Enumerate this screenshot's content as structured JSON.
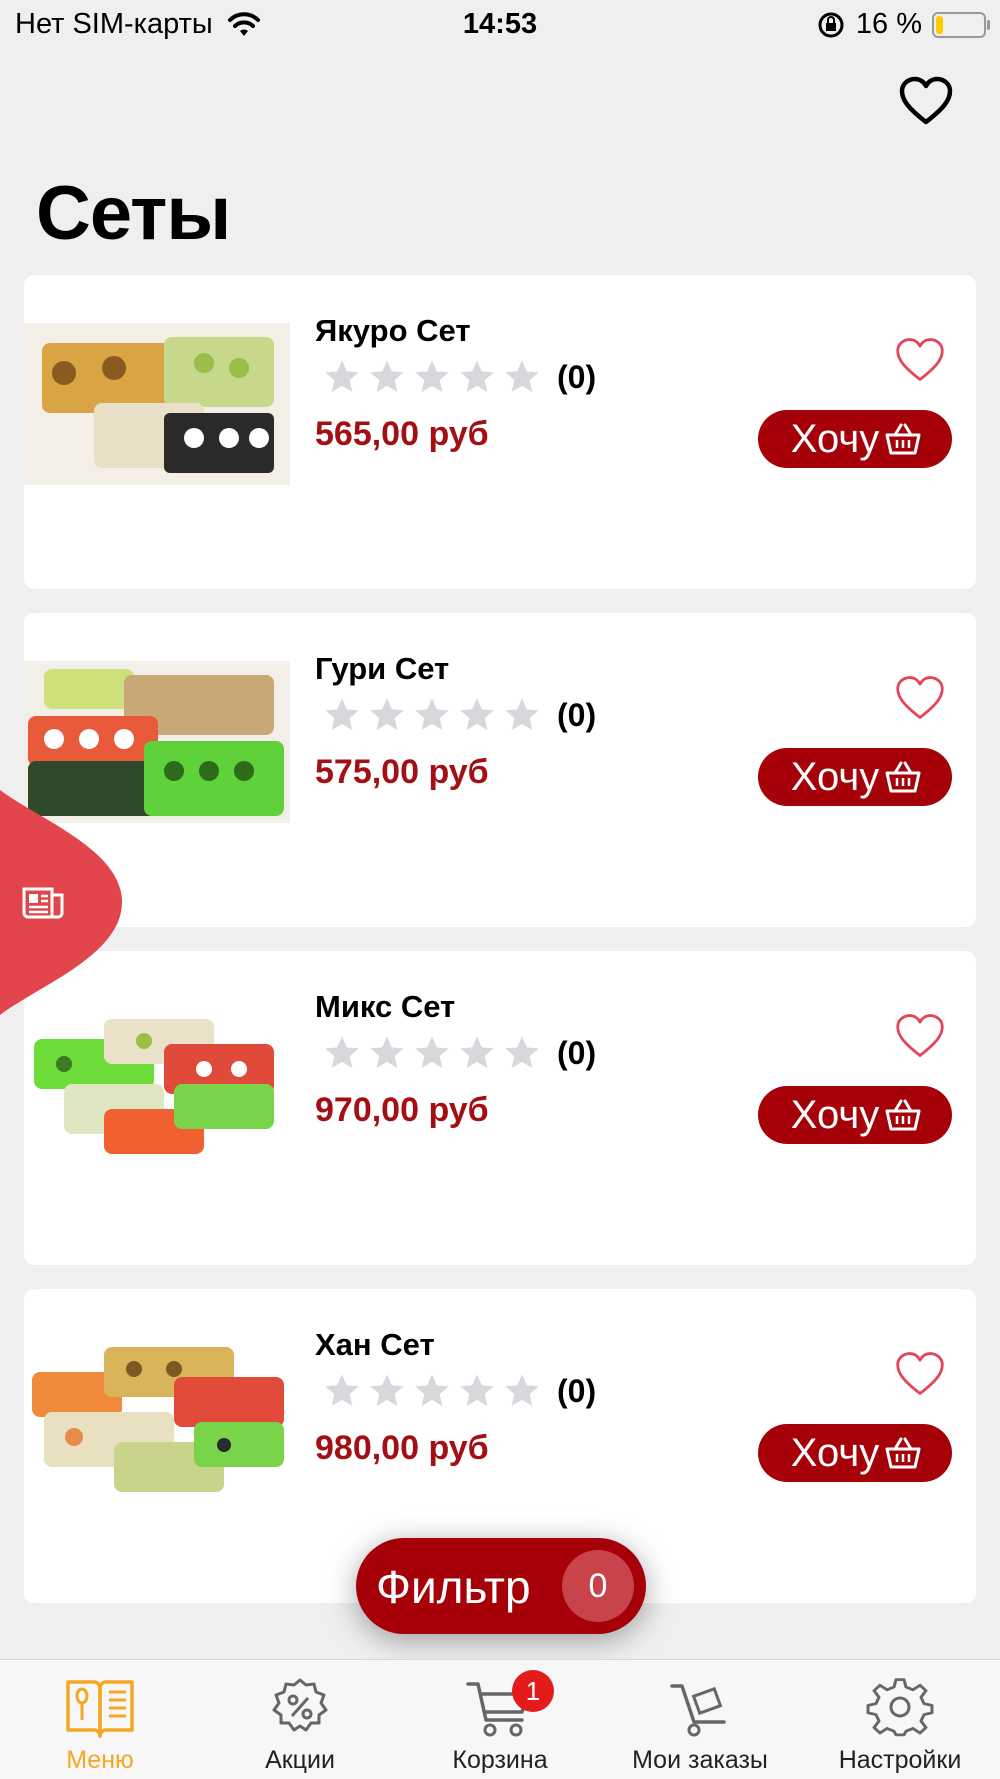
{
  "status_bar": {
    "carrier": "Нет SIM-карты",
    "time": "14:53",
    "battery_percent": "16 %",
    "battery_level": 0.16
  },
  "page": {
    "title": "Сеты"
  },
  "products": [
    {
      "name": "Якуро Сет",
      "rating": 0,
      "rating_count": "(0)",
      "price": "565,00 руб",
      "button": "Хочу"
    },
    {
      "name": "Гури Сет",
      "rating": 0,
      "rating_count": "(0)",
      "price": "575,00 руб",
      "button": "Хочу"
    },
    {
      "name": "Микс Сет",
      "rating": 0,
      "rating_count": "(0)",
      "price": "970,00 руб",
      "button": "Хочу"
    },
    {
      "name": "Хан Сет",
      "rating": 0,
      "rating_count": "(0)",
      "price": "980,00 руб",
      "button": "Хочу"
    }
  ],
  "filter": {
    "label": "Фильтр",
    "count": "0"
  },
  "tabbar": {
    "items": [
      {
        "label": "Меню",
        "icon": "menu-book-icon",
        "active": true
      },
      {
        "label": "Акции",
        "icon": "discount-gear-icon"
      },
      {
        "label": "Корзина",
        "icon": "cart-icon",
        "badge": "1"
      },
      {
        "label": "Мои заказы",
        "icon": "delivery-cart-icon"
      },
      {
        "label": "Настройки",
        "icon": "settings-gear-icon"
      }
    ]
  },
  "colors": {
    "accent": "#a60008",
    "price": "#a30f12",
    "heart": "#e4455a",
    "side_tab": "#e2454b",
    "active_tab": "#f5a623",
    "background": "#efefef"
  }
}
